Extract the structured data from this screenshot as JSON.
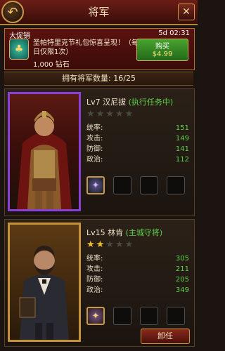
{
  "header": {
    "title": "将军",
    "back_icon": "back-arrow-icon",
    "close_icon": "close-icon"
  },
  "promo": {
    "label": "大促销",
    "timer": "5d 02:31",
    "description": "圣帕特里克节礼包惊喜呈现！（每日仅限1次）",
    "reward": "1,000 钻石",
    "buy_label": "购买",
    "price": "$4.99",
    "icon": "gift-pack-icon"
  },
  "roster": {
    "count_label": "拥有将军数量: 16/25"
  },
  "generals": [
    {
      "level_name": "Lv7 汉尼拔",
      "role": "(执行任务中)",
      "stars": 0,
      "max_stars": 5,
      "stats": [
        {
          "label": "统率:",
          "value": "151"
        },
        {
          "label": "攻击:",
          "value": "149"
        },
        {
          "label": "防御:",
          "value": "141"
        },
        {
          "label": "政治:",
          "value": "112"
        }
      ],
      "frame_color": "#8c3fd6"
    },
    {
      "level_name": "Lv15 林肯",
      "role": "(主城守将)",
      "stars": 2,
      "max_stars": 5,
      "stats": [
        {
          "label": "统率:",
          "value": "305"
        },
        {
          "label": "攻击:",
          "value": "211"
        },
        {
          "label": "防御:",
          "value": "205"
        },
        {
          "label": "政治:",
          "value": "349"
        }
      ],
      "frame_color": "#c8923a"
    }
  ],
  "actions": {
    "dismiss_label": "卸任"
  }
}
